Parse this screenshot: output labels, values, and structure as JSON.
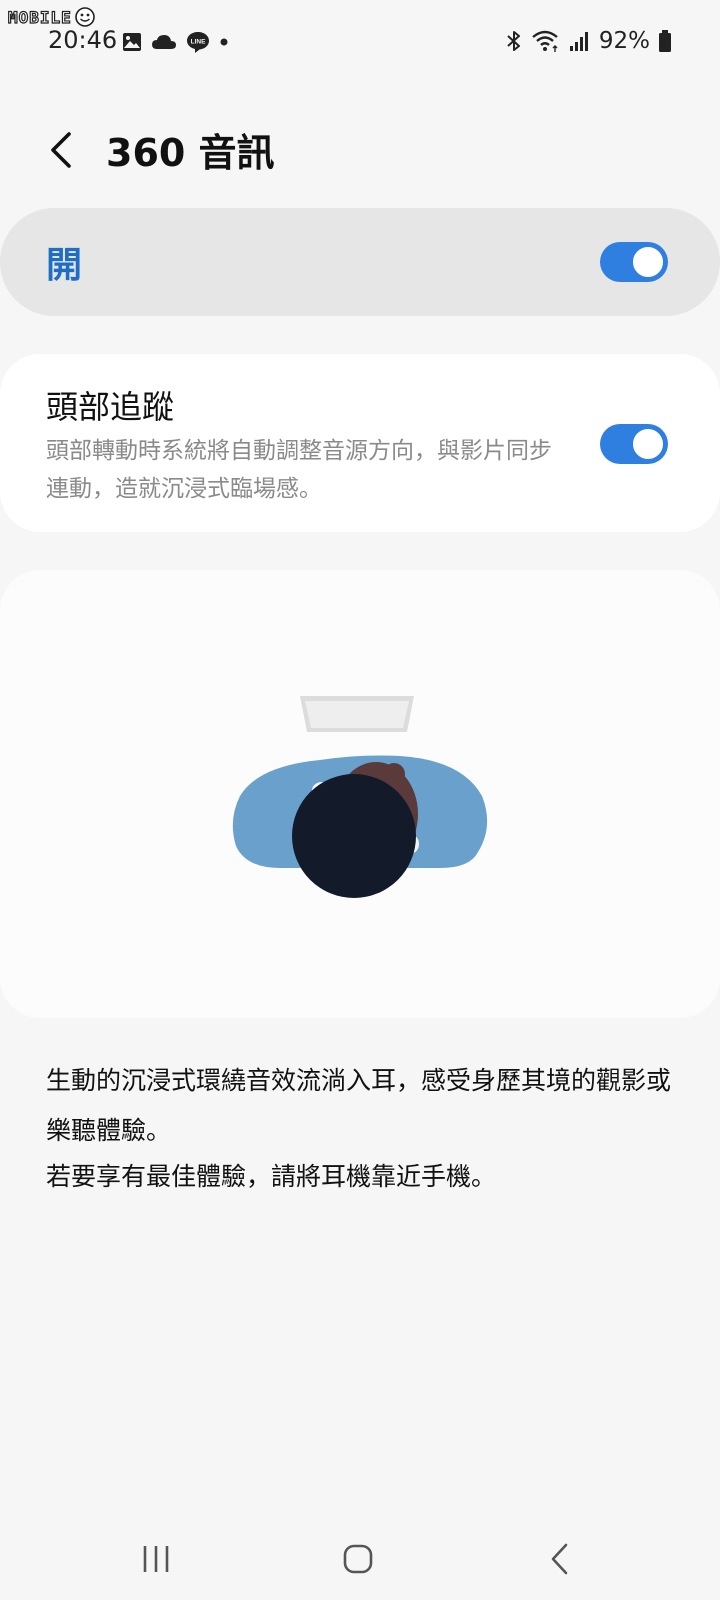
{
  "watermark": {
    "text": "MOBILE"
  },
  "status_bar": {
    "time": "20:46",
    "left_icons": [
      "gallery-icon",
      "cloud-icon",
      "line-icon",
      "dot-icon"
    ],
    "right_icons": [
      "bluetooth-icon",
      "wifi-icon",
      "signal-icon"
    ],
    "battery_percent": "92%"
  },
  "header": {
    "back_icon": "back-chevron-icon",
    "title": "360 音訊"
  },
  "master_switch": {
    "label": "開",
    "state": "on"
  },
  "head_tracking": {
    "title": "頭部追蹤",
    "description": "頭部轉動時系統將自動調整音源方向，與影片同步連動，造就沉浸式臨場感。",
    "state": "on"
  },
  "illustration": {
    "subject": "person-wearing-earbuds-facing-screen-illustration"
  },
  "description": {
    "line1": "生動的沉浸式環繞音效流淌入耳，感受身歷其境的觀影或樂聽體驗。",
    "line2": "若要享有最佳體驗，請將耳機靠近手機。"
  },
  "nav_bar": {
    "icons": [
      "recent-apps-icon",
      "home-icon",
      "back-icon"
    ]
  },
  "colors": {
    "accent": "#2f7fe0",
    "master_label": "#1d6ec4",
    "background": "#f6f6f6",
    "card": "#ffffff",
    "master_bg": "#e6e6e6",
    "secondary_text": "#8a8a8a",
    "shirt": "#6aa0cc",
    "hair": "#131a2a"
  }
}
